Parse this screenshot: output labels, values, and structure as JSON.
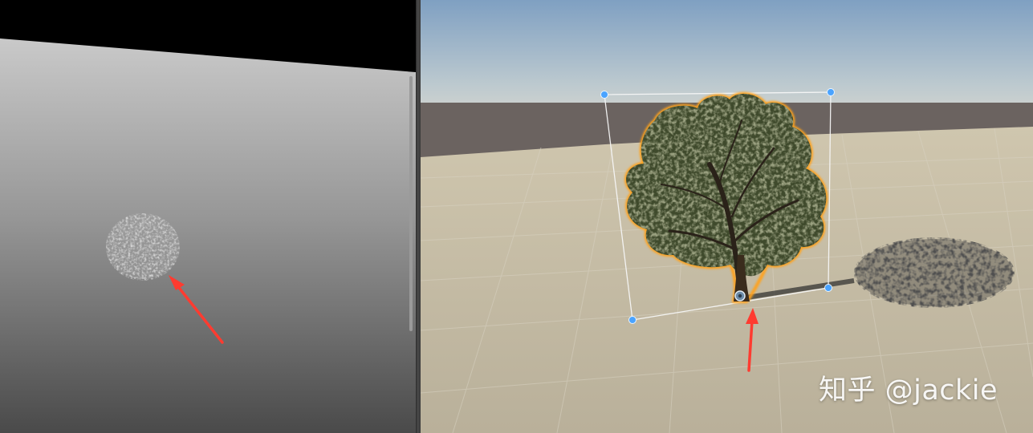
{
  "left_view": {
    "name": "depth-view",
    "arrow_color": "#ff3b30"
  },
  "right_view": {
    "name": "scene-view",
    "selection_outline_color": "#ffa21a",
    "gizmo_handle_color": "#4aa3ff",
    "arrow_color": "#ff3b30"
  },
  "watermark": {
    "text": "知乎 @jackie"
  },
  "icons": [
    "arrow-icon",
    "pivot-handle-icon",
    "rect-handle-icon"
  ]
}
